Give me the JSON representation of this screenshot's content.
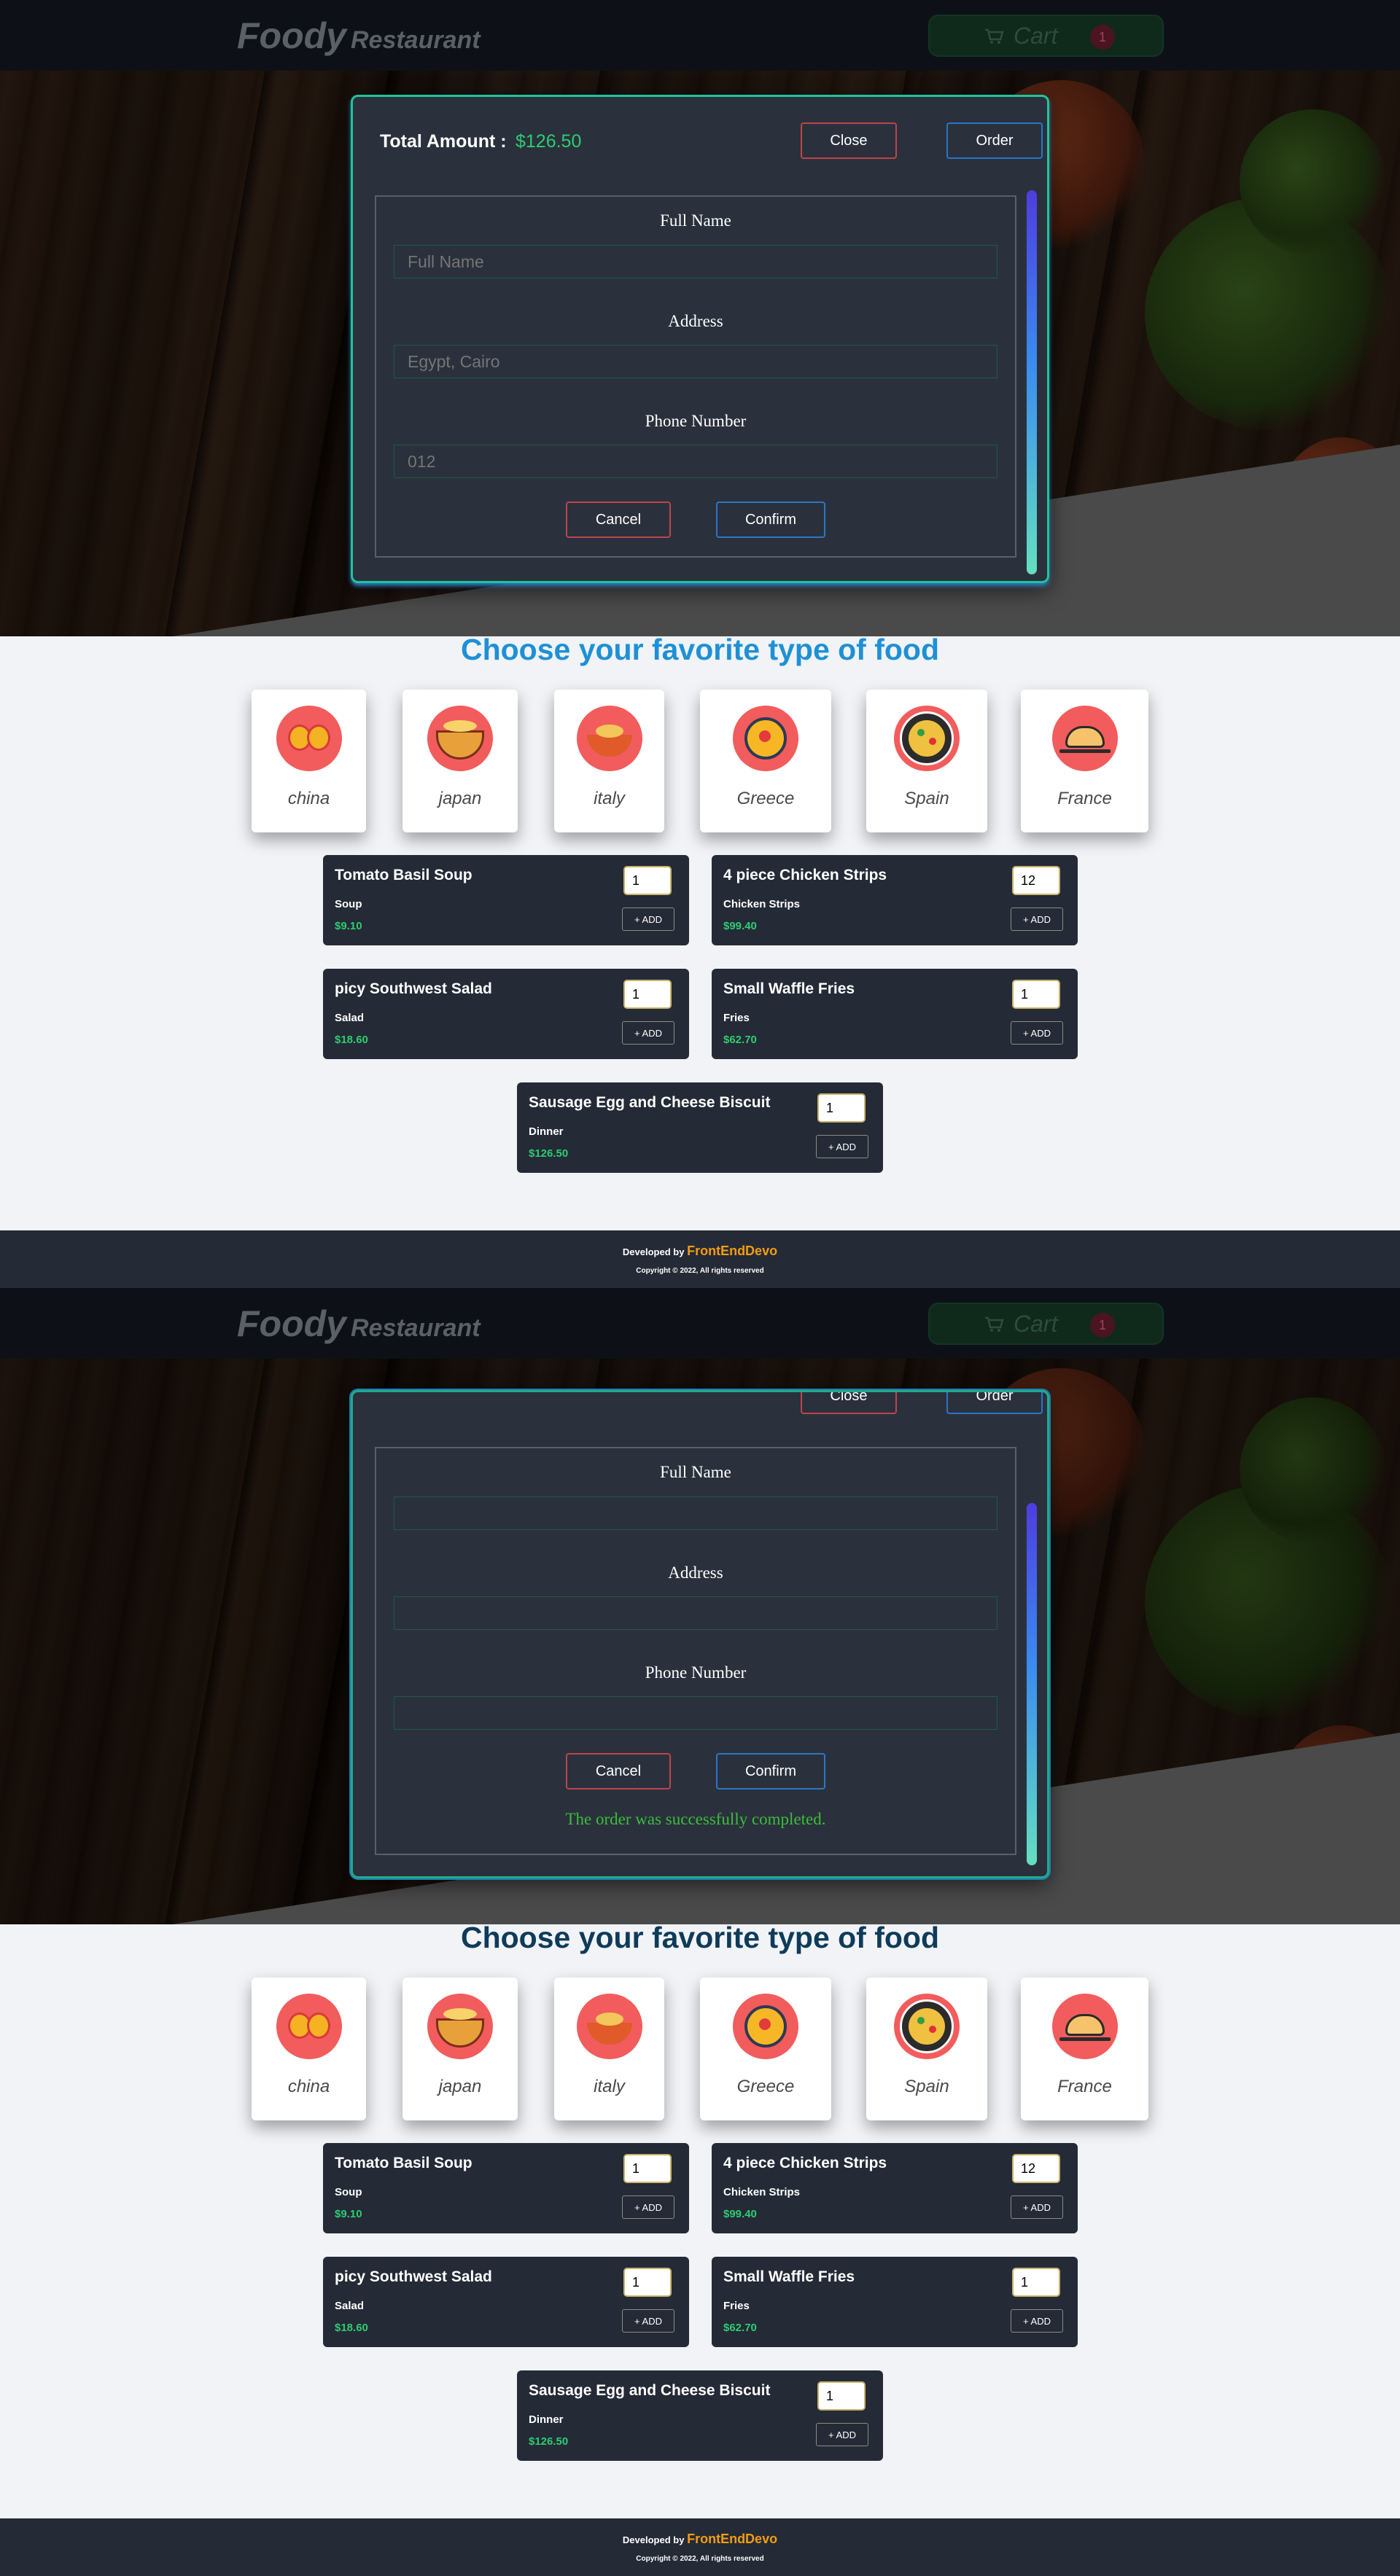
{
  "navbar": {
    "brand_main": "Foody",
    "brand_sub": "Restaurant",
    "cart_label": "Cart",
    "cart_count": "1"
  },
  "modal": {
    "total_label": "Total Amount :",
    "total_value": "$126.50",
    "close_label": "Close",
    "order_label": "Order",
    "fields": [
      {
        "label": "Full Name",
        "placeholder": "Full Name"
      },
      {
        "label": "Address",
        "placeholder": "Egypt, Cairo"
      },
      {
        "label": "Phone Number",
        "placeholder": "012"
      }
    ],
    "cancel_label": "Cancel",
    "confirm_label": "Confirm",
    "success_message": "The order was successfully completed."
  },
  "section_title": "Choose your favorite type of food",
  "categories": [
    {
      "name": "china",
      "icon": "dumplings-icon"
    },
    {
      "name": "japan",
      "icon": "ramen-bowl-icon"
    },
    {
      "name": "italy",
      "icon": "pasta-bowl-icon"
    },
    {
      "name": "Greece",
      "icon": "greek-dish-icon"
    },
    {
      "name": "Spain",
      "icon": "paella-icon"
    },
    {
      "name": "France",
      "icon": "croissant-icon"
    }
  ],
  "meals": [
    {
      "name": "Tomato Basil Soup",
      "type": "Soup",
      "price": "$9.10",
      "qty": "1",
      "add_label": "+ ADD"
    },
    {
      "name": "4 piece Chicken Strips",
      "type": "Chicken Strips",
      "price": "$99.40",
      "qty": "12",
      "add_label": "+ ADD"
    },
    {
      "name": "picy Southwest Salad",
      "type": "Salad",
      "price": "$18.60",
      "qty": "1",
      "add_label": "+ ADD"
    },
    {
      "name": "Small Waffle Fries",
      "type": "Fries",
      "price": "$62.70",
      "qty": "1",
      "add_label": "+ ADD"
    },
    {
      "name": "Sausage Egg and Cheese Biscuit",
      "type": "Dinner",
      "price": "$126.50",
      "qty": "1",
      "add_label": "+ ADD"
    }
  ],
  "footer": {
    "developed_by": "Developed by",
    "dev_name": "FrontEndDevo",
    "copyright": "Copyright © 2022, All rights reserved"
  },
  "colors": {
    "accent_green": "#2ecc71",
    "accent_blue": "#1e90d6",
    "danger": "#c0434a",
    "primary": "#2a76c9",
    "footer_brand": "#f39c12"
  }
}
